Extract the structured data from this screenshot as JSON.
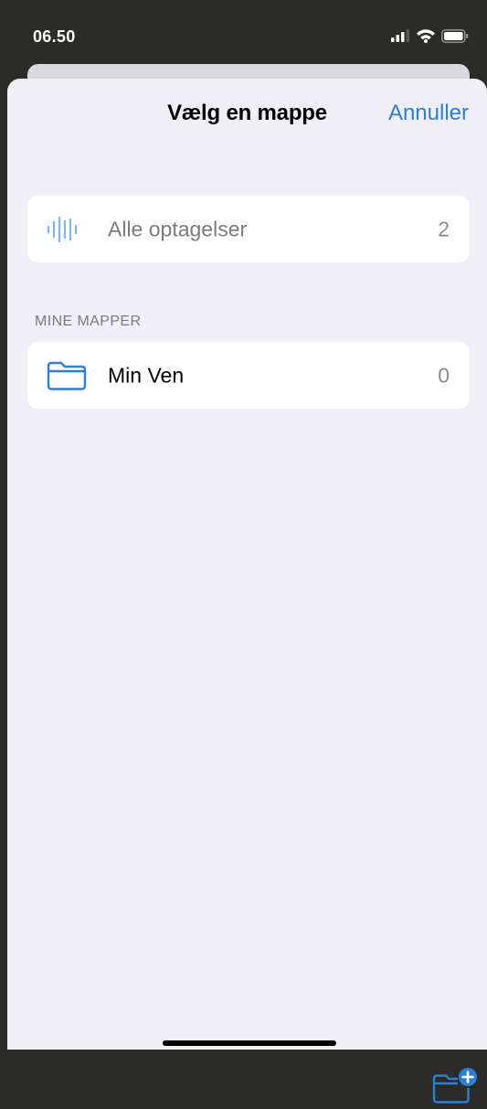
{
  "status_bar": {
    "time": "06.50"
  },
  "sheet": {
    "title": "Vælg en mappe",
    "cancel_label": "Annuller"
  },
  "all_recordings": {
    "label": "Alle optagelser",
    "count": "2",
    "icon": "waveform-icon"
  },
  "my_folders": {
    "header": "MINE MAPPER",
    "items": [
      {
        "label": "Min Ven",
        "count": "0",
        "icon": "folder-icon"
      }
    ]
  },
  "toolbar": {
    "new_folder_icon": "new-folder-icon"
  },
  "colors": {
    "accent": "#2c7fd6",
    "background": "#f0eff5",
    "status_bar": "#2b2b28"
  }
}
